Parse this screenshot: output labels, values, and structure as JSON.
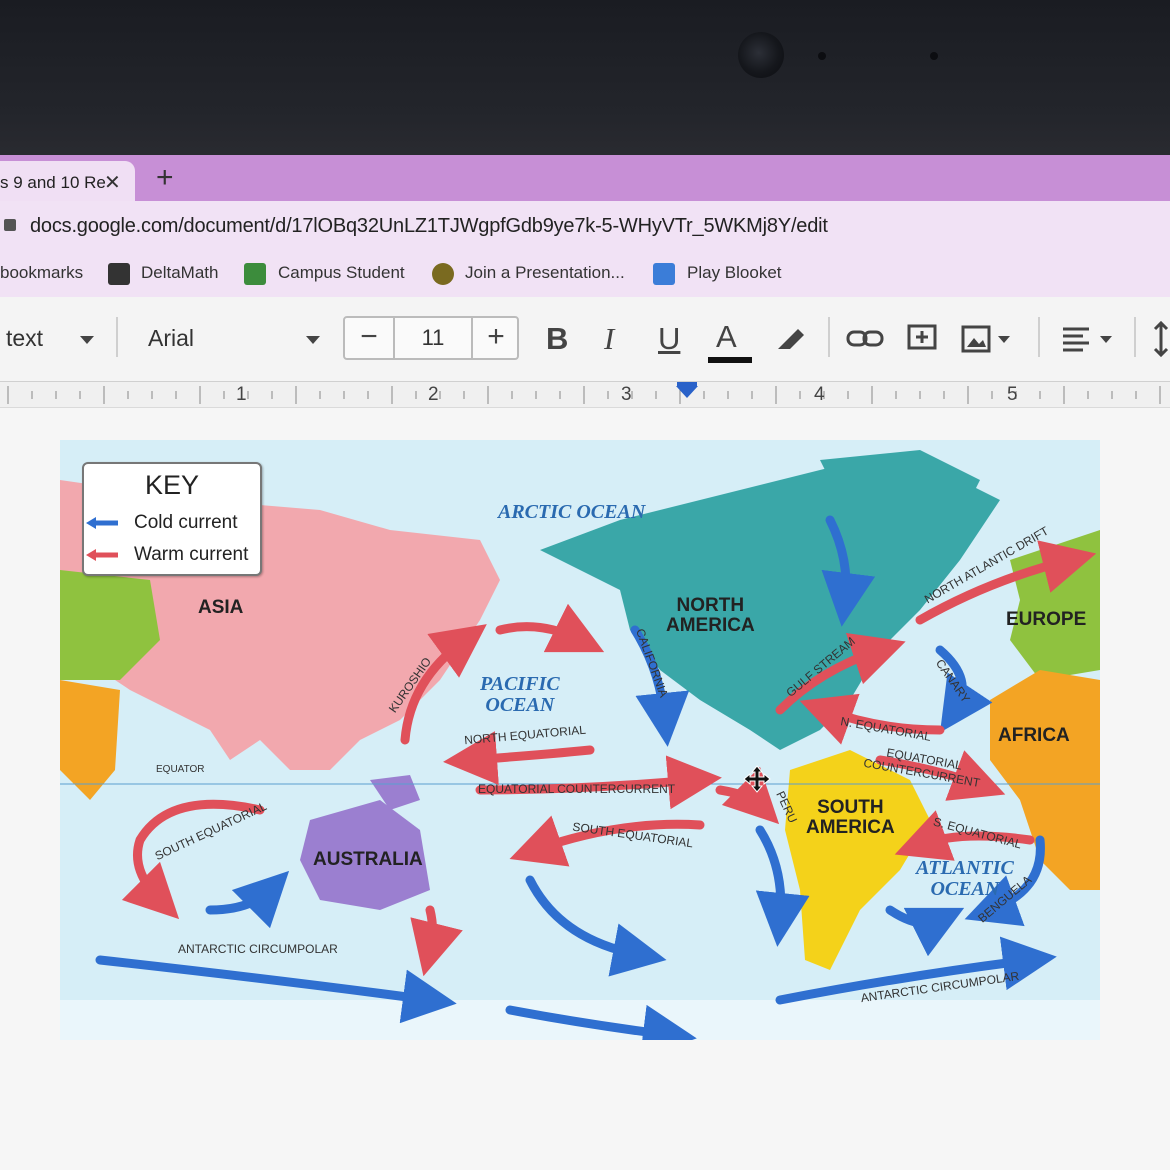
{
  "browser": {
    "tab_title": "s 9 and 10 Re",
    "tab_close": "✕",
    "new_tab": "+",
    "url": "docs.google.com/document/d/17lOBq32UnLZ1TJWgpfGdb9ye7k-5-WHyVTr_5WKMj8Y/edit",
    "bookmarks": [
      {
        "label": "bookmarks"
      },
      {
        "label": "DeltaMath",
        "icon_color": "#333333"
      },
      {
        "label": "Campus Student",
        "icon_color": "#3c8c3c"
      },
      {
        "label": "Join a Presentation...",
        "icon_color": "#7a6a20"
      },
      {
        "label": "Play Blooket",
        "icon_color": "#3b7dd8"
      }
    ]
  },
  "toolbar": {
    "style": "text",
    "font": "Arial",
    "font_size_minus": "−",
    "font_size": "11",
    "font_size_plus": "+",
    "bold": "B",
    "italic": "I",
    "underline": "U",
    "text_color": "A"
  },
  "ruler": {
    "marks": [
      "1",
      "2",
      "3",
      "4",
      "5"
    ]
  },
  "map": {
    "key": {
      "title": "KEY",
      "cold": "Cold current",
      "warm": "Warm current",
      "cold_color": "#2f6fd0",
      "warm_color": "#e0505a"
    },
    "continents": {
      "asia": "ASIA",
      "north_america": "NORTH\nAMERICA",
      "europe": "EUROPE",
      "africa": "AFRICA",
      "south_america": "SOUTH\nAMERICA",
      "australia": "AUSTRALIA"
    },
    "oceans": {
      "arctic": "ARCTIC OCEAN",
      "pacific": "PACIFIC\nOCEAN",
      "atlantic": "ATLANTIC\nOCEAN"
    },
    "currents": {
      "kuroshio": "KUROSHIO",
      "california": "CALIFORNIA",
      "gulf_stream": "GULF STREAM",
      "north_atlantic_drift": "NORTH ATLANTIC DRIFT",
      "canary": "CANARY",
      "n_equatorial": "N. EQUATORIAL",
      "north_equatorial": "NORTH EQUATORIAL",
      "equatorial_countercurrent_pacific": "EQUATORIAL COUNTERCURRENT",
      "equatorial_countercurrent_atlantic": "EQUATORIAL\nCOUNTERCURRENT",
      "equator": "EQUATOR",
      "peru": "PERU",
      "south_equatorial_pacific": "SOUTH EQUATORIAL",
      "south_equatorial_indian": "SOUTH EQUATORIAL",
      "s_equatorial": "S. EQUATORIAL",
      "benguela": "BENGUELA",
      "antarctic_1": "ANTARCTIC CIRCUMPOLAR",
      "antarctic_2": "ANTARCTIC CIRCUMPOLAR"
    },
    "colors": {
      "ocean": "#d6eef7",
      "asia": "#f2a8ae",
      "north_america": "#3aa7a8",
      "europe": "#8fc23f",
      "africa": "#f3a424",
      "south_america": "#f4d21a",
      "australia": "#9b7fd0",
      "cold": "#2f6fd0",
      "warm": "#e0505a"
    }
  }
}
